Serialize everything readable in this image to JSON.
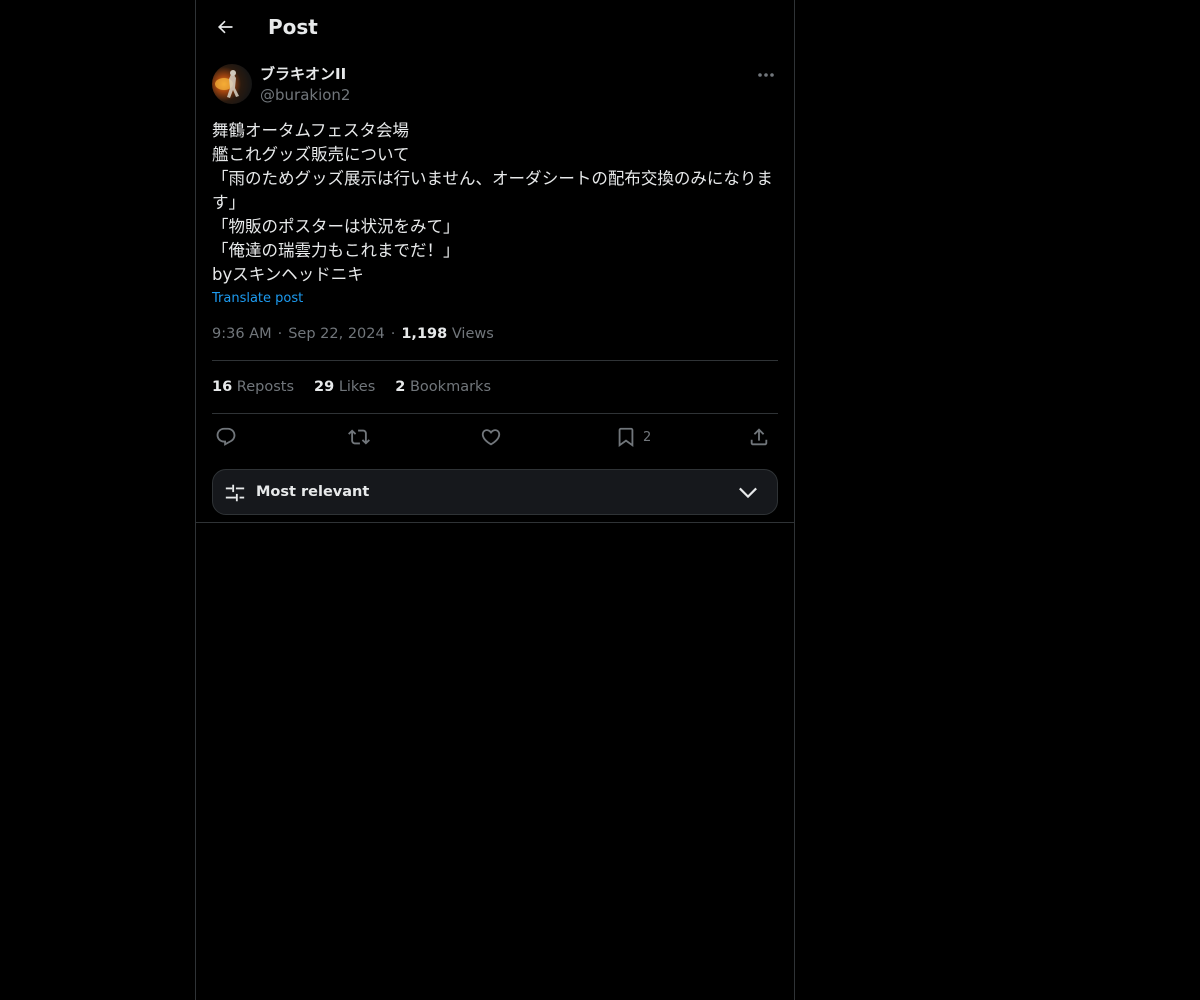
{
  "header": {
    "title": "Post"
  },
  "author": {
    "display_name": "ブラキオンII",
    "handle": "@burakion2"
  },
  "post": {
    "lines": [
      "舞鶴オータムフェスタ会場",
      "艦これグッズ販売について",
      "「雨のためグッズ展示は行いません、オーダシートの配布交換のみになります」",
      "「物販のポスターは状況をみて」",
      "「俺達の瑞雲力もこれまでだ！」",
      "byスキンヘッドニキ"
    ],
    "translate_label": "Translate post",
    "time": "9:36 AM",
    "date": "Sep 22, 2024",
    "views_count": "1,198",
    "views_label": "Views"
  },
  "stats": {
    "reposts_count": "16",
    "reposts_label": "Reposts",
    "likes_count": "29",
    "likes_label": "Likes",
    "bookmarks_count": "2",
    "bookmarks_label": "Bookmarks"
  },
  "actions": {
    "bookmark_count": "2",
    "icons": [
      "reply-icon",
      "repost-icon",
      "like-icon",
      "bookmark-icon",
      "share-icon"
    ]
  },
  "sort": {
    "label": "Most relevant"
  },
  "colors": {
    "background": "#000000",
    "text": "#e7e9ea",
    "secondary": "#71767b",
    "link": "#1d9bf0",
    "border": "#2f3336"
  }
}
